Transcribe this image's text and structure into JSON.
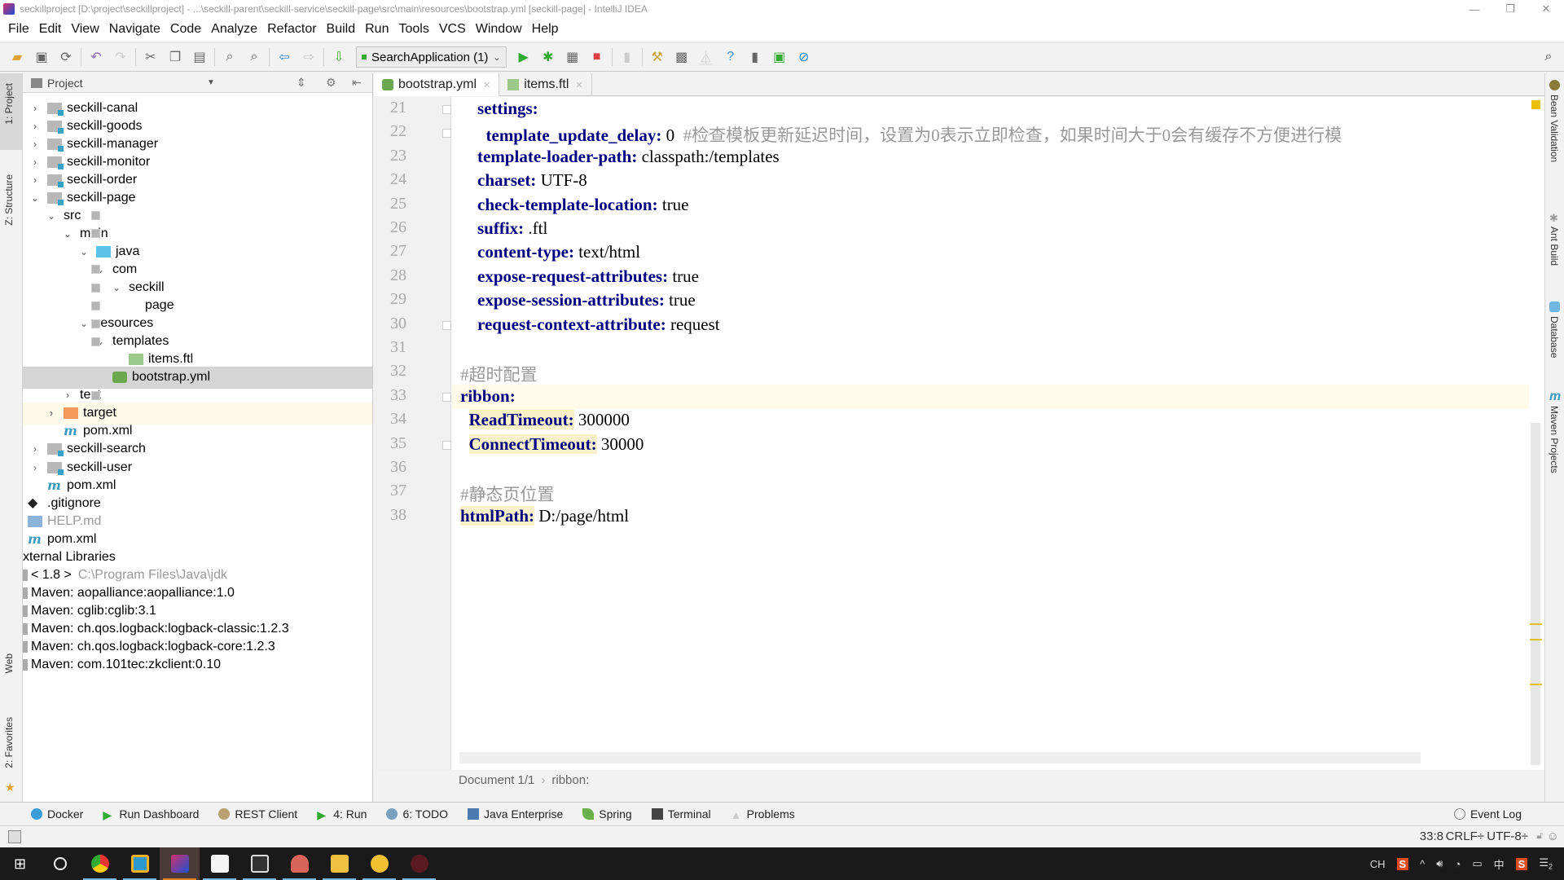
{
  "window": {
    "title": "seckillproject [D:\\project\\seckillproject] - ...\\seckill-parent\\seckill-service\\seckill-page\\src\\main\\resources\\bootstrap.yml [seckill-page] - IntelliJ IDEA",
    "controls": {
      "minimize": "—",
      "restore": "❐",
      "close": "✕"
    }
  },
  "menu": [
    "File",
    "Edit",
    "View",
    "Navigate",
    "Code",
    "Analyze",
    "Refactor",
    "Build",
    "Run",
    "Tools",
    "VCS",
    "Window",
    "Help"
  ],
  "toolbar": {
    "run_config": "SearchApplication (1)",
    "buttons": [
      "open-folder",
      "save-all",
      "synchronize",
      "undo",
      "redo",
      "cut",
      "copy",
      "paste",
      "find",
      "replace",
      "back",
      "forward",
      "build",
      "run",
      "debug",
      "coverage",
      "stop",
      "attach",
      "project-structure",
      "sdk",
      "vcs",
      "help",
      "terminal",
      "vm",
      "power-save",
      "search-everywhere"
    ]
  },
  "left_stripe": {
    "tabs": [
      "1: Project",
      "Z: Structure",
      "Web",
      "2: Favorites"
    ]
  },
  "right_stripe": {
    "tabs": [
      "Bean Validation",
      "Ant Build",
      "Database",
      "Maven Projects"
    ]
  },
  "project_panel": {
    "title": "Project",
    "tree": [
      {
        "label": "seckill-canal",
        "depth": 0,
        "arrow": "›",
        "icon": "module",
        "state": "collapsed"
      },
      {
        "label": "seckill-goods",
        "depth": 0,
        "arrow": "›",
        "icon": "module",
        "state": "collapsed"
      },
      {
        "label": "seckill-manager",
        "depth": 0,
        "arrow": "›",
        "icon": "module",
        "state": "collapsed"
      },
      {
        "label": "seckill-monitor",
        "depth": 0,
        "arrow": "›",
        "icon": "module",
        "state": "collapsed"
      },
      {
        "label": "seckill-order",
        "depth": 0,
        "arrow": "›",
        "icon": "module",
        "state": "collapsed"
      },
      {
        "label": "seckill-page",
        "depth": 0,
        "arrow": "⌄",
        "icon": "module",
        "state": "expanded"
      },
      {
        "label": "src",
        "depth": 1,
        "arrow": "⌄",
        "icon": "folder",
        "state": "expanded"
      },
      {
        "label": "main",
        "depth": 2,
        "arrow": "⌄",
        "icon": "folder",
        "state": "expanded"
      },
      {
        "label": "java",
        "depth": 3,
        "arrow": "⌄",
        "icon": "java",
        "state": "expanded"
      },
      {
        "label": "com",
        "depth": 4,
        "arrow": "⌄",
        "icon": "folder",
        "state": "expanded"
      },
      {
        "label": "seckill",
        "depth": 5,
        "arrow": "⌄",
        "icon": "folder",
        "state": "expanded"
      },
      {
        "label": "page",
        "depth": 6,
        "arrow": "",
        "icon": "folder",
        "state": "leaf"
      },
      {
        "label": "resources",
        "depth": 3,
        "arrow": "⌄",
        "icon": "folder",
        "state": "expanded"
      },
      {
        "label": "templates",
        "depth": 4,
        "arrow": "⌄",
        "icon": "folder",
        "state": "expanded"
      },
      {
        "label": "items.ftl",
        "depth": 5,
        "arrow": "",
        "icon": "ftl",
        "state": "leaf"
      },
      {
        "label": "bootstrap.yml",
        "depth": 4,
        "arrow": "",
        "icon": "yml",
        "state": "selected"
      },
      {
        "label": "test",
        "depth": 2,
        "arrow": "›",
        "icon": "folder",
        "state": "collapsed"
      },
      {
        "label": "target",
        "depth": 1,
        "arrow": "›",
        "icon": "target",
        "state": "highlighted"
      },
      {
        "label": "pom.xml",
        "depth": 1,
        "arrow": "",
        "icon": "maven",
        "state": "leaf"
      },
      {
        "label": "seckill-search",
        "depth": 0,
        "arrow": "›",
        "icon": "module",
        "state": "collapsed"
      },
      {
        "label": "seckill-user",
        "depth": 0,
        "arrow": "›",
        "icon": "module",
        "state": "collapsed"
      },
      {
        "label": "pom.xml",
        "depth": 0,
        "arrow": "",
        "icon": "maven",
        "state": "leaf"
      },
      {
        "label": ".gitignore",
        "depth": -1,
        "arrow": "",
        "icon": "git",
        "state": "leaf"
      },
      {
        "label": "HELP.md",
        "depth": -1,
        "arrow": "",
        "icon": "md",
        "state": "dimmed"
      },
      {
        "label": "pom.xml",
        "depth": -1,
        "arrow": "",
        "icon": "maven",
        "state": "leaf"
      },
      {
        "label": "xternal Libraries",
        "depth": -2,
        "arrow": "",
        "icon": "none",
        "state": "leaf"
      },
      {
        "label": "< 1.8 >",
        "suffix": "C:\\Program Files\\Java\\jdk",
        "depth": -2,
        "arrow": "",
        "icon": "lib",
        "state": "leaf"
      },
      {
        "label": "Maven: aopalliance:aopalliance:1.0",
        "depth": -2,
        "arrow": "",
        "icon": "lib",
        "state": "leaf"
      },
      {
        "label": "Maven: cglib:cglib:3.1",
        "depth": -2,
        "arrow": "",
        "icon": "lib",
        "state": "leaf"
      },
      {
        "label": "Maven: ch.qos.logback:logback-classic:1.2.3",
        "depth": -2,
        "arrow": "",
        "icon": "lib",
        "state": "leaf"
      },
      {
        "label": "Maven: ch.qos.logback:logback-core:1.2.3",
        "depth": -2,
        "arrow": "",
        "icon": "lib",
        "state": "leaf"
      },
      {
        "label": "Maven: com.101tec:zkclient:0.10",
        "depth": -2,
        "arrow": "",
        "icon": "lib",
        "state": "leaf"
      }
    ]
  },
  "editor": {
    "tabs": [
      {
        "label": "bootstrap.yml",
        "active": true
      },
      {
        "label": "items.ftl",
        "active": false
      }
    ],
    "lines": [
      {
        "num": "21",
        "indent": "    ",
        "key": "settings:",
        "value": "",
        "comment": ""
      },
      {
        "num": "22",
        "indent": "      ",
        "key": "template_update_delay:",
        "value": " 0  ",
        "comment": "#检查模板更新延迟时间，设置为0表示立即检查，如果时间大于0会有缓存不方便进行模"
      },
      {
        "num": "23",
        "indent": "    ",
        "key": "template-loader-path:",
        "value": " classpath:/templates",
        "comment": ""
      },
      {
        "num": "24",
        "indent": "    ",
        "key": "charset:",
        "value": " UTF-8",
        "comment": ""
      },
      {
        "num": "25",
        "indent": "    ",
        "key": "check-template-location:",
        "value": " true",
        "comment": ""
      },
      {
        "num": "26",
        "indent": "    ",
        "key": "suffix:",
        "value": " .ftl",
        "comment": ""
      },
      {
        "num": "27",
        "indent": "    ",
        "key": "content-type:",
        "value": " text/html",
        "comment": ""
      },
      {
        "num": "28",
        "indent": "    ",
        "key": "expose-request-attributes:",
        "value": " true",
        "comment": ""
      },
      {
        "num": "29",
        "indent": "    ",
        "key": "expose-session-attributes:",
        "value": " true",
        "comment": ""
      },
      {
        "num": "30",
        "indent": "    ",
        "key": "request-context-attribute:",
        "value": " request",
        "comment": ""
      },
      {
        "num": "31",
        "indent": "",
        "key": "",
        "value": "",
        "comment": ""
      },
      {
        "num": "32",
        "indent": "",
        "key": "",
        "value": "",
        "comment": "#超时配置"
      },
      {
        "num": "33",
        "indent": "",
        "key": "ribbon:",
        "value": "",
        "comment": ""
      },
      {
        "num": "34",
        "indent": "  ",
        "key": "ReadTimeout:",
        "value": " 300000",
        "comment": ""
      },
      {
        "num": "35",
        "indent": "  ",
        "key": "ConnectTimeout:",
        "value": " 30000",
        "comment": ""
      },
      {
        "num": "36",
        "indent": "",
        "key": "",
        "value": "",
        "comment": ""
      },
      {
        "num": "37",
        "indent": "",
        "key": "",
        "value": "",
        "comment": "#静态页位置"
      },
      {
        "num": "38",
        "indent": "",
        "key": "htmlPath:",
        "value": " D:/page/html",
        "comment": ""
      }
    ],
    "breadcrumb": [
      "Document 1/1",
      "ribbon:"
    ]
  },
  "bottom_tools": [
    "Docker",
    "Run Dashboard",
    "REST Client",
    "4: Run",
    "6: TODO",
    "Java Enterprise",
    "Spring",
    "Terminal",
    "Problems"
  ],
  "event_log": "Event Log",
  "status": {
    "position": "33:8",
    "line_sep": "CRLF÷",
    "encoding": "UTF-8÷"
  },
  "taskbar": {
    "apps": [
      "start",
      "cortana",
      "chrome",
      "app-blue",
      "intellij-idea",
      "typora",
      "terminal-app",
      "app-red",
      "file-explorer",
      "app-squirrel",
      "app-dark-red"
    ],
    "tray": {
      "lang": "CH",
      "ime": "中",
      "notifications": "2"
    }
  }
}
